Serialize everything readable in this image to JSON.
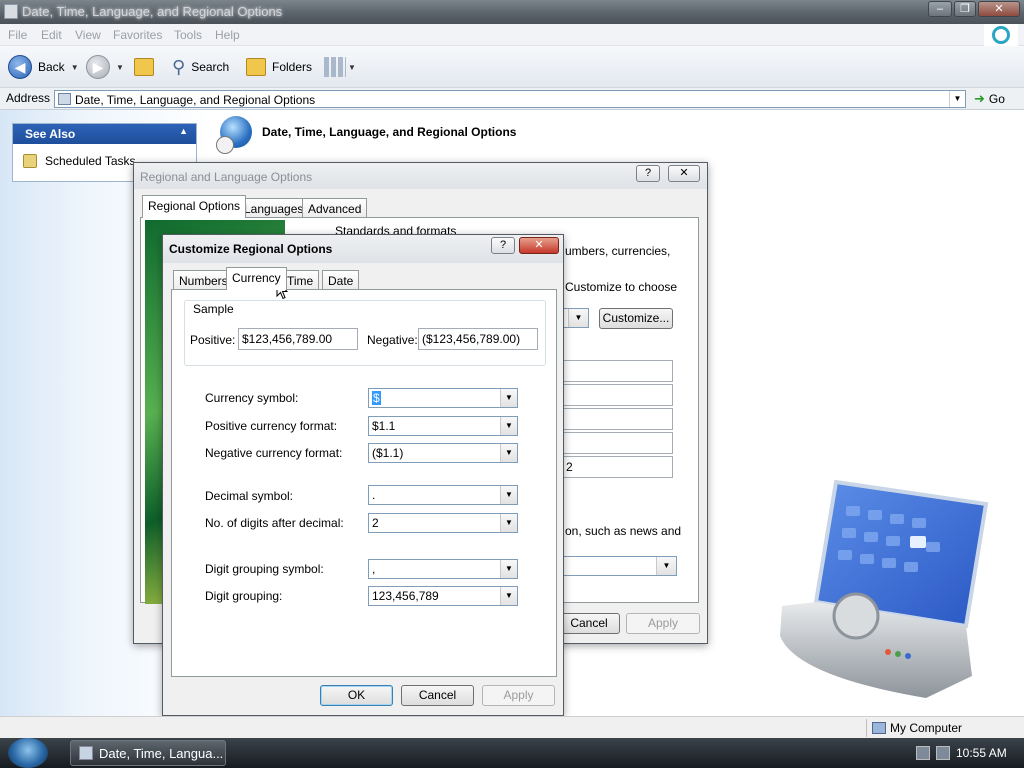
{
  "window": {
    "title": "Date, Time, Language, and Regional Options"
  },
  "menu": [
    "File",
    "Edit",
    "View",
    "Favorites",
    "Tools",
    "Help"
  ],
  "toolbar": {
    "back": "Back",
    "search": "Search",
    "folders": "Folders"
  },
  "address": {
    "label": "Address",
    "value": "Date, Time, Language, and Regional Options",
    "go": "Go"
  },
  "see_also": {
    "header": "See Also",
    "items": [
      "Scheduled Tasks"
    ]
  },
  "page": {
    "title": "Date, Time, Language, and Regional Options"
  },
  "regional_dialog": {
    "title": "Regional and Language Options",
    "tabs": [
      "Regional Options",
      "Languages",
      "Advanced"
    ],
    "group_title": "Standards and formats",
    "text1": "umbers, currencies,",
    "text2": "Customize to choose",
    "customize_label": "Customize...",
    "field_last": "2",
    "location_text": "on, such as news and",
    "cancel_label": "Cancel",
    "apply_label": "Apply"
  },
  "customize_dialog": {
    "title": "Customize Regional Options",
    "tabs": [
      "Numbers",
      "Currency",
      "Time",
      "Date"
    ],
    "sample": {
      "title": "Sample",
      "positive_label": "Positive:",
      "positive_value": "$123,456,789.00",
      "negative_label": "Negative:",
      "negative_value": "($123,456,789.00)"
    },
    "fields": [
      {
        "label": "Currency symbol:",
        "value": "$"
      },
      {
        "label": "Positive currency format:",
        "value": "$1.1"
      },
      {
        "label": "Negative currency format:",
        "value": "($1.1)"
      },
      {
        "label": "Decimal symbol:",
        "value": "."
      },
      {
        "label": "No. of digits after decimal:",
        "value": "2"
      },
      {
        "label": "Digit grouping symbol:",
        "value": ","
      },
      {
        "label": "Digit grouping:",
        "value": "123,456,789"
      }
    ],
    "ok": "OK",
    "cancel": "Cancel",
    "apply": "Apply"
  },
  "statusbar": {
    "zone": "My Computer"
  },
  "taskbar": {
    "task": "Date, Time, Langua...",
    "clock": "10:55 AM"
  }
}
